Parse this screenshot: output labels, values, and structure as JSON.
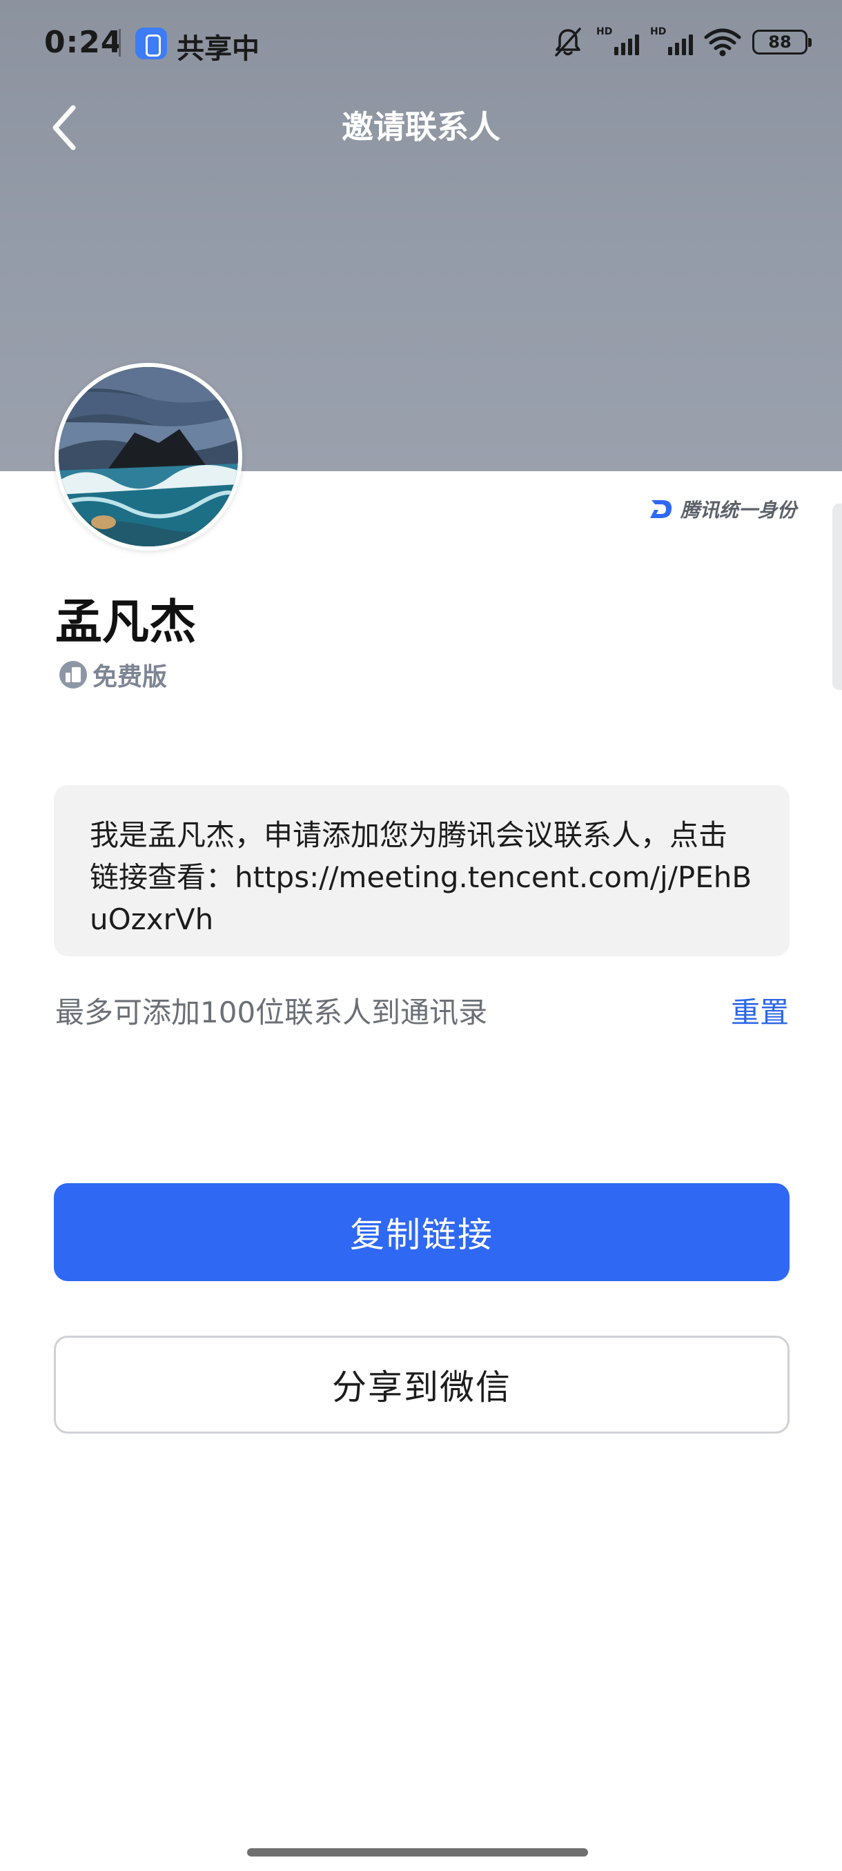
{
  "status_bar": {
    "time": "0:24",
    "share_status": "共享中",
    "signal_label": "HD",
    "battery": "88"
  },
  "header": {
    "title": "邀请联系人"
  },
  "brand": {
    "label": "腾讯统一身份"
  },
  "profile": {
    "name": "孟凡杰",
    "edition": "免费版"
  },
  "invite": {
    "message": "我是孟凡杰，申请添加您为腾讯会议联系人，点击链接查看：https://meeting.tencent.com/j/PEhBuOzxrVh"
  },
  "limit": {
    "text": "最多可添加100位联系人到通讯录",
    "reset_label": "重置"
  },
  "actions": {
    "copy_label": "复制链接",
    "share_label": "分享到微信"
  },
  "colors": {
    "primary": "#2f68f3",
    "link": "#2b66e8",
    "hero": "#959ca9"
  }
}
